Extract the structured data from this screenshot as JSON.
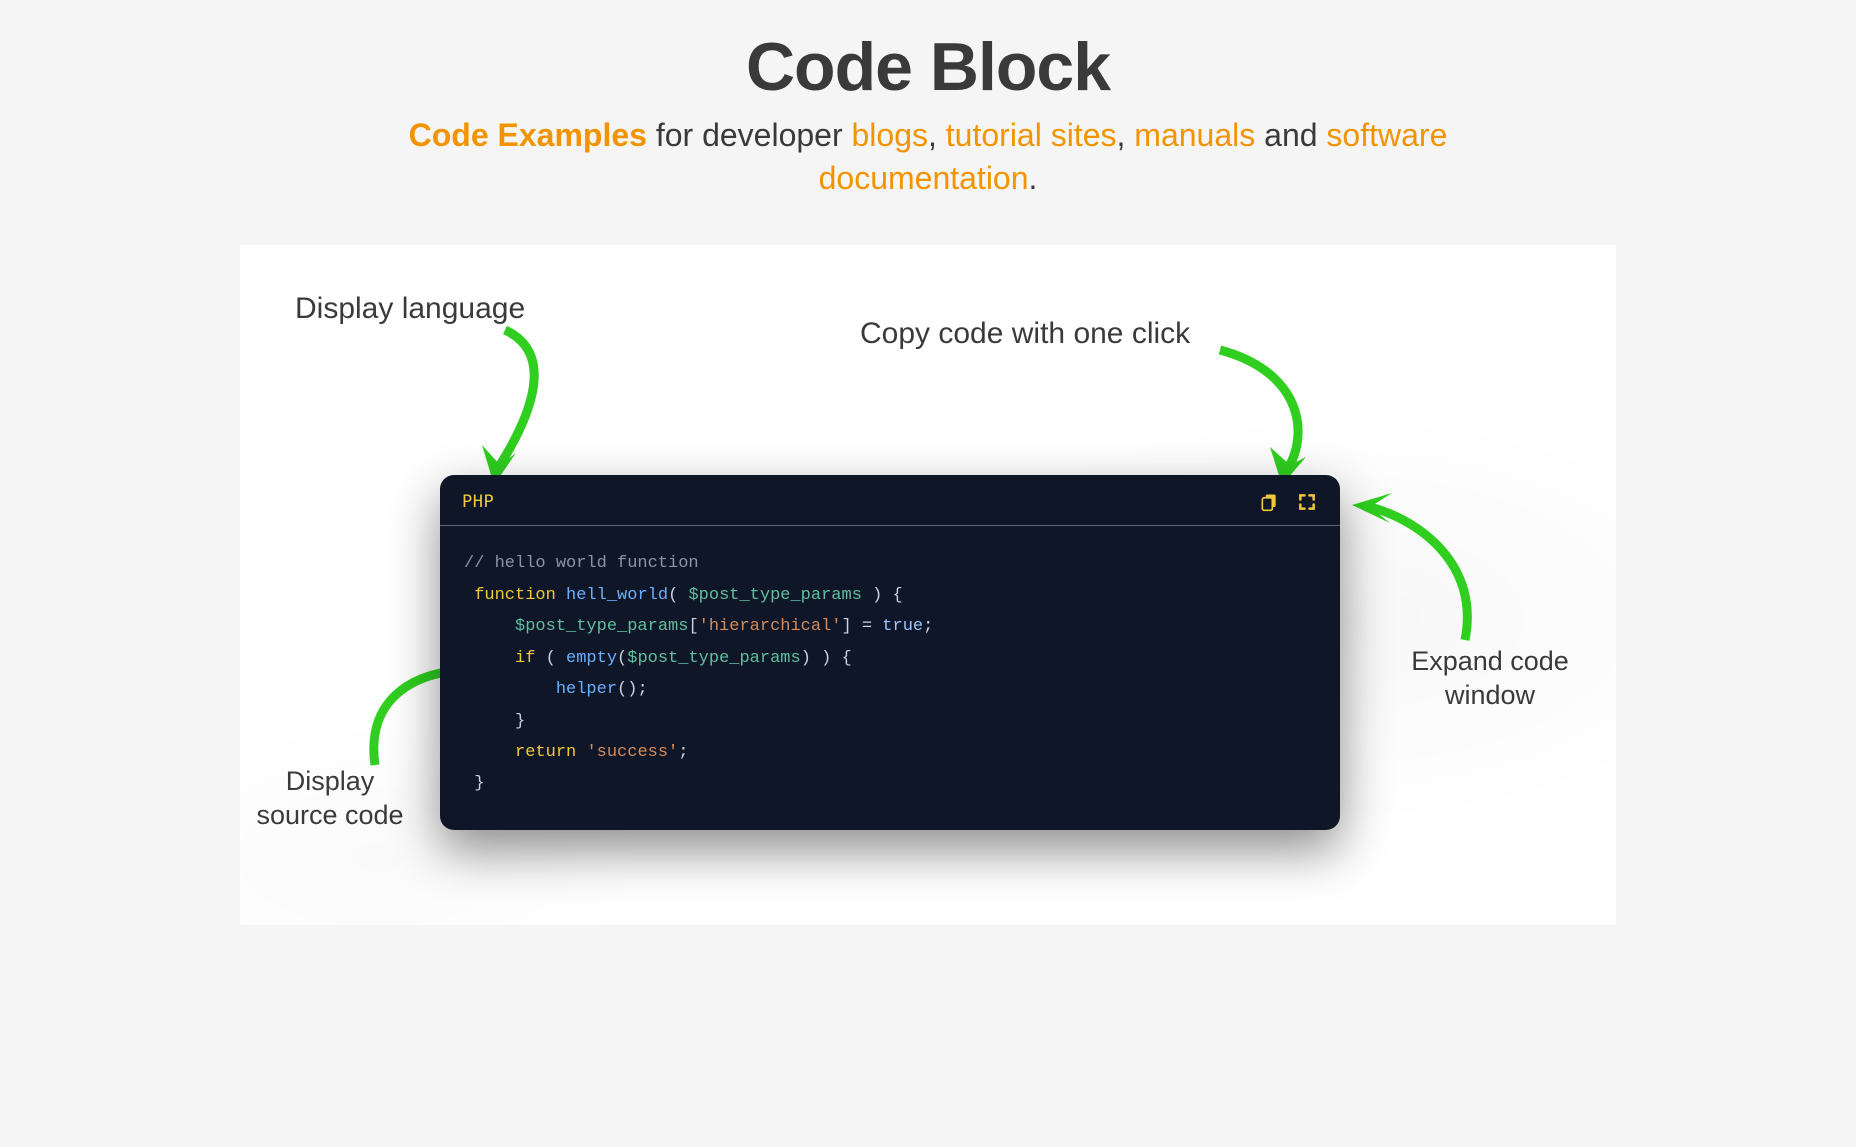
{
  "title": "Code Block",
  "subtitle": {
    "lead": "Code Examples",
    "t1": " for developer ",
    "h1": "blogs",
    "sep1": ", ",
    "h2": "tutorial sites",
    "sep2": ", ",
    "h3": "manuals",
    "t2": " and ",
    "h4": "software documentation",
    "period": "."
  },
  "annotations": {
    "display_language": "Display language",
    "copy_code": "Copy code with one click",
    "display_source": "Display\nsource code",
    "expand_code": "Expand code\nwindow"
  },
  "code_block": {
    "language": "PHP",
    "icons": {
      "copy": "copy-icon",
      "expand": "expand-icon"
    },
    "tokens": [
      [
        [
          "comment",
          "// hello world function"
        ]
      ],
      [
        [
          "plain",
          " "
        ],
        [
          "keyword",
          "function"
        ],
        [
          "plain",
          " "
        ],
        [
          "func",
          "hell_world"
        ],
        [
          "punct",
          "( "
        ],
        [
          "var",
          "$post_type_params"
        ],
        [
          "punct",
          " ) {"
        ]
      ],
      [
        [
          "plain",
          "     "
        ],
        [
          "var",
          "$post_type_params"
        ],
        [
          "punct",
          "["
        ],
        [
          "string",
          "'hierarchical'"
        ],
        [
          "punct",
          "] = "
        ],
        [
          "lit",
          "true"
        ],
        [
          "punct",
          ";"
        ]
      ],
      [
        [
          "plain",
          "     "
        ],
        [
          "keyword",
          "if"
        ],
        [
          "punct",
          " ( "
        ],
        [
          "func",
          "empty"
        ],
        [
          "punct",
          "("
        ],
        [
          "var",
          "$post_type_params"
        ],
        [
          "punct",
          ") ) {"
        ]
      ],
      [
        [
          "plain",
          "         "
        ],
        [
          "func",
          "helper"
        ],
        [
          "punct",
          "();"
        ]
      ],
      [
        [
          "plain",
          "     "
        ],
        [
          "punct",
          "}"
        ]
      ],
      [
        [
          "plain",
          "     "
        ],
        [
          "keyword",
          "return"
        ],
        [
          "plain",
          " "
        ],
        [
          "string",
          "'success'"
        ],
        [
          "punct",
          ";"
        ]
      ],
      [
        [
          "plain",
          " "
        ],
        [
          "punct",
          "}"
        ]
      ]
    ]
  },
  "colors": {
    "accent": "#f29400",
    "arrow": "#2fce1f"
  }
}
